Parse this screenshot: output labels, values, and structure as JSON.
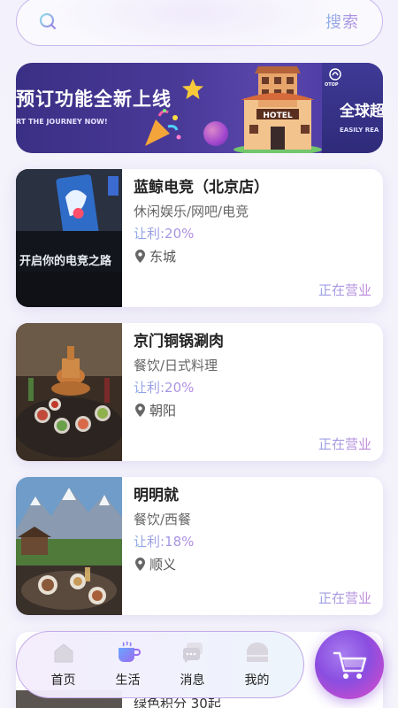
{
  "search": {
    "button_label": "搜索"
  },
  "banner": {
    "title": "预订功能全新上线",
    "subtitle": "RT THE JOURNEY NOW!",
    "hotel_sign": "HOTEL",
    "right_title": "全球超",
    "right_subtitle": "EASILY REA",
    "logo_text": "OTOP"
  },
  "shops": [
    {
      "name": "蓝鲸电竞（北京店）",
      "category": "休闲娱乐/网吧/电竞",
      "discount": "让利:20%",
      "location": "东城",
      "status": "正在营业",
      "image_sign": "开启你的电竞之路"
    },
    {
      "name": "京门铜锅涮肉",
      "category": "餐饮/日式料理",
      "discount": "让利:20%",
      "location": "朝阳",
      "status": "正在营业"
    },
    {
      "name": "明明就",
      "category": "餐饮/西餐",
      "discount": "让利:18%",
      "location": "顺义",
      "status": "正在营业"
    }
  ],
  "partial_shop": {
    "text": "绿色积分 30起"
  },
  "nav": {
    "items": [
      {
        "label": "首页",
        "icon": "home-icon"
      },
      {
        "label": "生活",
        "icon": "coffee-icon"
      },
      {
        "label": "消息",
        "icon": "message-icon"
      },
      {
        "label": "我的",
        "icon": "profile-icon"
      }
    ],
    "cart_icon": "cart-icon"
  },
  "colors": {
    "accent_gradient_start": "#8fb3e8",
    "accent_gradient_end": "#b48be0",
    "banner_bg": "#3a2f85",
    "cart_button": "#8a4ee0"
  }
}
